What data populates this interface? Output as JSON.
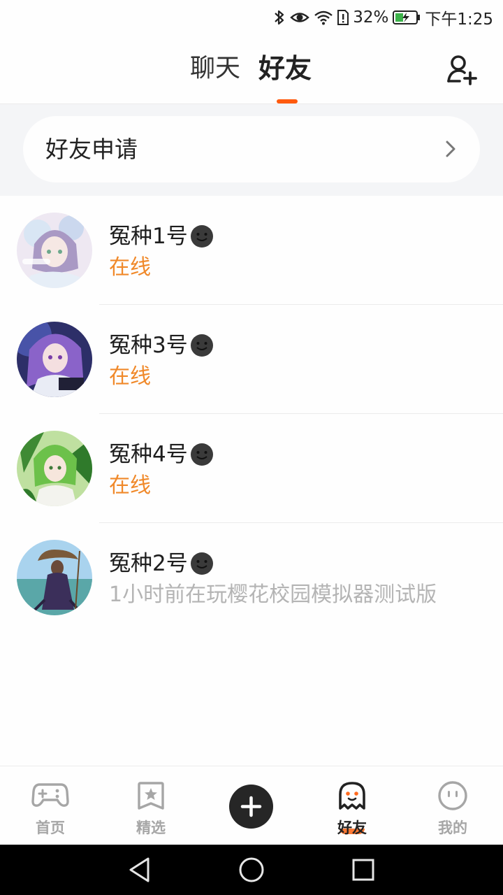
{
  "status_bar": {
    "battery_percent": "32%",
    "time": "下午1:25"
  },
  "header": {
    "tab_chat": "聊天",
    "tab_friends": "好友",
    "active_tab": "好友"
  },
  "friend_request": {
    "label": "好友申请"
  },
  "friends": [
    {
      "name": "冤种1号",
      "status": "在线",
      "online": true
    },
    {
      "name": "冤种3号",
      "status": "在线",
      "online": true
    },
    {
      "name": "冤种4号",
      "status": "在线",
      "online": true
    },
    {
      "name": "冤种2号",
      "status": "1小时前在玩樱花校园模拟器测试版",
      "online": false
    }
  ],
  "bottom_nav": {
    "items": [
      {
        "label": "首页",
        "icon": "gamepad-icon"
      },
      {
        "label": "精选",
        "icon": "star-bookmark-icon"
      },
      {
        "label": "",
        "icon": "plus-icon"
      },
      {
        "label": "好友",
        "icon": "ghost-icon",
        "active": true
      },
      {
        "label": "我的",
        "icon": "face-icon"
      }
    ]
  },
  "colors": {
    "accent": "#ff5a0e",
    "online": "#f0892a",
    "offline": "#b4b4b4"
  }
}
